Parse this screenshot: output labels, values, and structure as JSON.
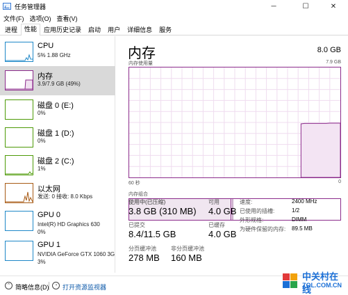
{
  "window": {
    "title": "任务管理器",
    "minimize": "─",
    "maximize": "☐",
    "close": "✕"
  },
  "menu": [
    "文件(F)",
    "选项(O)",
    "查看(V)"
  ],
  "tabs": [
    "进程",
    "性能",
    "应用历史记录",
    "启动",
    "用户",
    "详细信息",
    "服务"
  ],
  "active_tab": "性能",
  "left_items": [
    {
      "name": "CPU",
      "sub1": "5% 1.88 GHz",
      "sub2": "",
      "color": "#1e88c8"
    },
    {
      "name": "内存",
      "sub1": "3.9/7.9 GB (49%)",
      "sub2": "",
      "color": "#8b2b8b"
    },
    {
      "name": "磁盘 0 (E:)",
      "sub1": "0%",
      "sub2": "",
      "color": "#4d9a06"
    },
    {
      "name": "磁盘 1 (D:)",
      "sub1": "0%",
      "sub2": "",
      "color": "#4d9a06"
    },
    {
      "name": "磁盘 2 (C:)",
      "sub1": "1%",
      "sub2": "",
      "color": "#4d9a06"
    },
    {
      "name": "以太网",
      "sub1": "发送: 0 接收: 8.0 Kbps",
      "sub2": "",
      "color": "#a75a14"
    },
    {
      "name": "GPU 0",
      "sub1": "Intel(R) HD Graphics 630",
      "sub2": "0%",
      "color": "#1e88c8"
    },
    {
      "name": "GPU 1",
      "sub1": "NVIDIA GeForce GTX 1060 3G",
      "sub2": "3%",
      "color": "#1e88c8"
    }
  ],
  "memory": {
    "title": "内存",
    "total": "8.0 GB",
    "usage_label": "内存使用量",
    "usage_max": "7.9 GB",
    "time_left": "60 秒",
    "time_right": "0",
    "composition_label": "内存组合",
    "usage_history": [
      0,
      0,
      0,
      0,
      0,
      0,
      0,
      0,
      0,
      0,
      0,
      0,
      0,
      0,
      0,
      0,
      0,
      0,
      0,
      0,
      0,
      0,
      0,
      0,
      0,
      0,
      0,
      0,
      0,
      0,
      0,
      0,
      0,
      0,
      0,
      0,
      0,
      0,
      0,
      0,
      0,
      0,
      0,
      0,
      0,
      0,
      0,
      0,
      3.85,
      3.88,
      3.88,
      3.88,
      3.88,
      3.88,
      3.88,
      3.88,
      3.9,
      3.9,
      3.9,
      3.9
    ],
    "stats": {
      "in_use_label": "使用中(已压缩)",
      "in_use": "3.8 GB (310 MB)",
      "available_label": "可用",
      "available": "4.0 GB",
      "committed_label": "已提交",
      "committed": "8.4/11.5 GB",
      "cached_label": "已缓存",
      "cached": "4.0 GB",
      "paged_label": "分页缓冲池",
      "paged": "278 MB",
      "nonpaged_label": "非分页缓冲池",
      "nonpaged": "160 MB"
    },
    "details": [
      {
        "key": "速度:",
        "value": "2400 MHz"
      },
      {
        "key": "已使用的插槽:",
        "value": "1/2"
      },
      {
        "key": "外形规格:",
        "value": "DIMM"
      },
      {
        "key": "为硬件保留的内存:",
        "value": "89.5 MB"
      }
    ]
  },
  "footer": {
    "less": "简略信息(D)",
    "resource_monitor": "打开资源监视器"
  },
  "watermark": {
    "name": "中关村在线",
    "url": "ZOL.COM.CN"
  }
}
